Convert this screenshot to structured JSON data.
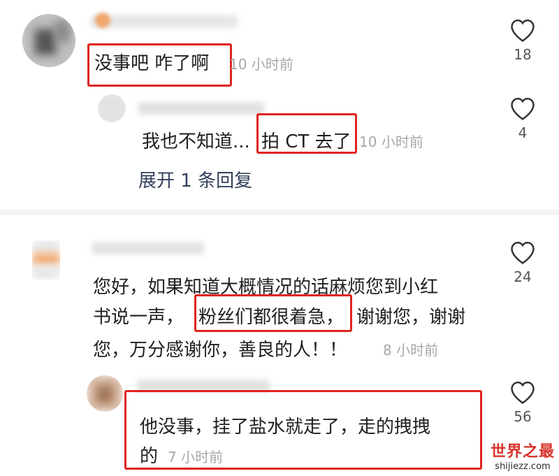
{
  "comments": [
    {
      "text_a": "没事吧 咋了啊",
      "time": "10 小时前",
      "likes": "18"
    },
    {
      "text_a": "我也不知道...",
      "text_b": "拍 CT 去了",
      "time": "10 小时前",
      "likes": "4"
    },
    {
      "expand": "展开 1 条回复"
    },
    {
      "line1": "您好，如果知道大概情况的话麻烦您到小红",
      "line2_a": "书说一声，",
      "line2_b": "粉丝们都很着急，",
      "line2_c": "谢谢您，谢谢",
      "line3": "您，万分感谢你，善良的人！！",
      "time": "8 小时前",
      "likes": "24"
    },
    {
      "line1": "他没事，挂了盐水就走了，走的拽拽",
      "line2": "的",
      "time": "7 小时前",
      "likes": "56"
    }
  ],
  "watermark": {
    "title": "世界之最",
    "url": "shijiezz.com"
  },
  "colors": {
    "highlight": "#e0241f",
    "timestamp": "#a8a8a8",
    "divider": "#f4f4f4"
  }
}
